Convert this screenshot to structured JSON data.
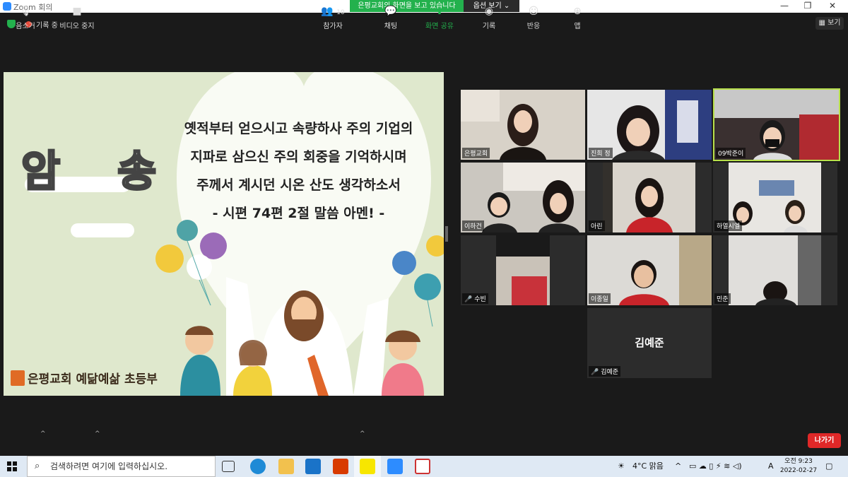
{
  "window": {
    "title": "Zoom 회의",
    "minimize": "—",
    "restore": "❐",
    "close": "✕"
  },
  "share_banner": {
    "message": "은평교회의 화면을 보고 있습니다",
    "options_label": "옵션 보기 ⌄"
  },
  "topbar": {
    "recording_label": "기록 중",
    "view_label": "보기",
    "view_icon": "grid-icon"
  },
  "slide": {
    "title": "암 송",
    "verse_lines": [
      "옛적부터 얻으시고 속량하사 주의 기업의",
      "지파로 삼으신 주의 회중을 기억하시며",
      "주께서 계시던 시온 산도 생각하소서",
      "- 시편 74편 2절 말씀 아멘! -"
    ],
    "church_label": "은평교회 예닮예삶 초등부"
  },
  "participants": [
    {
      "name": "은평교회",
      "muted": false
    },
    {
      "name": "진희 정",
      "muted": false
    },
    {
      "name": "09박준이",
      "muted": false,
      "active_speaker": true
    },
    {
      "name": "이하건",
      "muted": false
    },
    {
      "name": "아린",
      "muted": false
    },
    {
      "name": "하열시엘",
      "muted": false
    },
    {
      "name": "수빈",
      "muted": true
    },
    {
      "name": "이종일",
      "muted": false
    },
    {
      "name": "민준",
      "muted": false
    },
    {
      "name": "김예준",
      "muted": true,
      "video_off": true
    }
  ],
  "toolbar": {
    "mute": "음소거",
    "stop_video": "비디오 중지",
    "participants": "참가자",
    "participant_count": "10",
    "chat": "채팅",
    "share_screen": "화면 공유",
    "record": "기록",
    "reactions": "반응",
    "apps": "앱",
    "leave": "나가기"
  },
  "taskbar": {
    "search_placeholder": "검색하려면 여기에 입력하십시오.",
    "weather": "4°C  맑음",
    "ime": "A",
    "time": "오전 9:23",
    "date": "2022-02-27"
  },
  "colors": {
    "accent_green": "#23b14d",
    "leave_red": "#e02828",
    "active_speaker": "#b7e04b"
  }
}
